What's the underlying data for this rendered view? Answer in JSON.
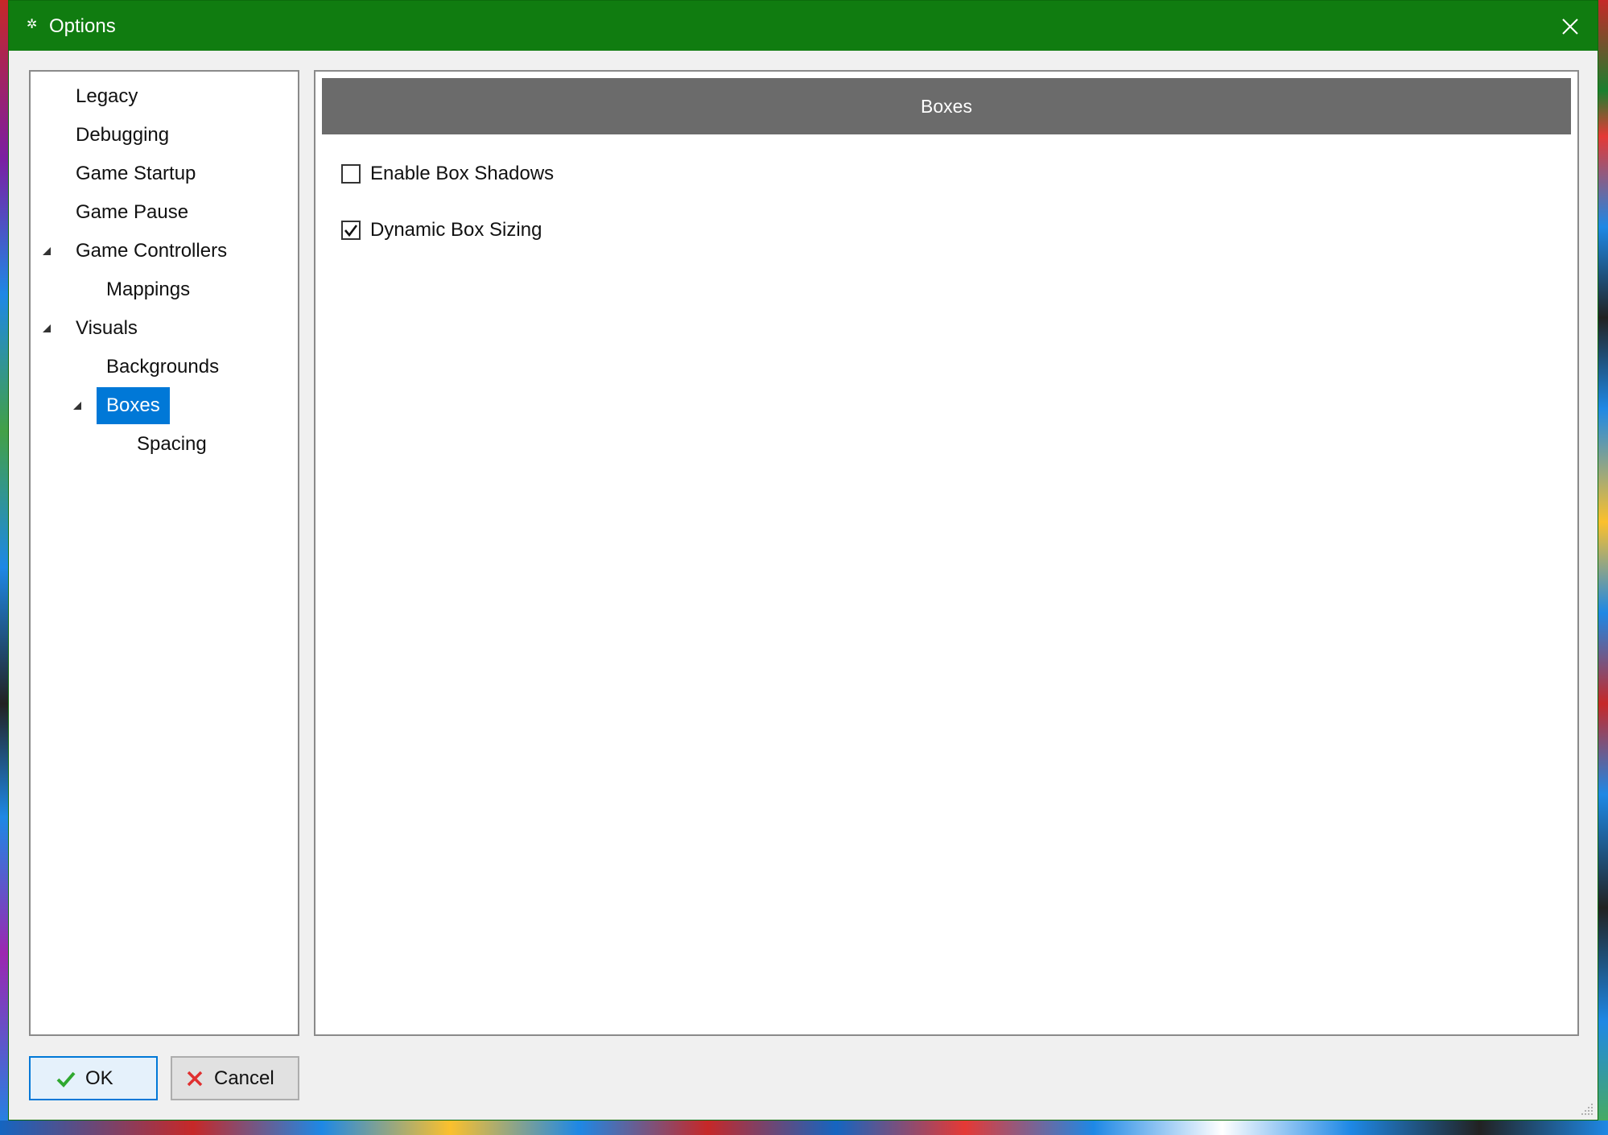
{
  "window": {
    "title": "Options",
    "title_icon": "gear-icon",
    "titlebar_color": "#107c10"
  },
  "tree": {
    "items": [
      {
        "label": "Legacy",
        "level": 0,
        "expandable": false
      },
      {
        "label": "Debugging",
        "level": 0,
        "expandable": false
      },
      {
        "label": "Game Startup",
        "level": 0,
        "expandable": false
      },
      {
        "label": "Game Pause",
        "level": 0,
        "expandable": false
      },
      {
        "label": "Game Controllers",
        "level": 0,
        "expandable": true,
        "expanded": true
      },
      {
        "label": "Mappings",
        "level": 1,
        "expandable": false
      },
      {
        "label": "Visuals",
        "level": 0,
        "expandable": true,
        "expanded": true
      },
      {
        "label": "Backgrounds",
        "level": 1,
        "expandable": false
      },
      {
        "label": "Boxes",
        "level": 1,
        "expandable": true,
        "expanded": true,
        "selected": true
      },
      {
        "label": "Spacing",
        "level": 2,
        "expandable": false
      }
    ],
    "selection_color": "#0078d7"
  },
  "content": {
    "header": "Boxes",
    "options": [
      {
        "label": "Enable Box Shadows",
        "checked": false
      },
      {
        "label": "Dynamic Box Sizing",
        "checked": true
      }
    ]
  },
  "buttons": {
    "ok_label": "OK",
    "cancel_label": "Cancel"
  }
}
